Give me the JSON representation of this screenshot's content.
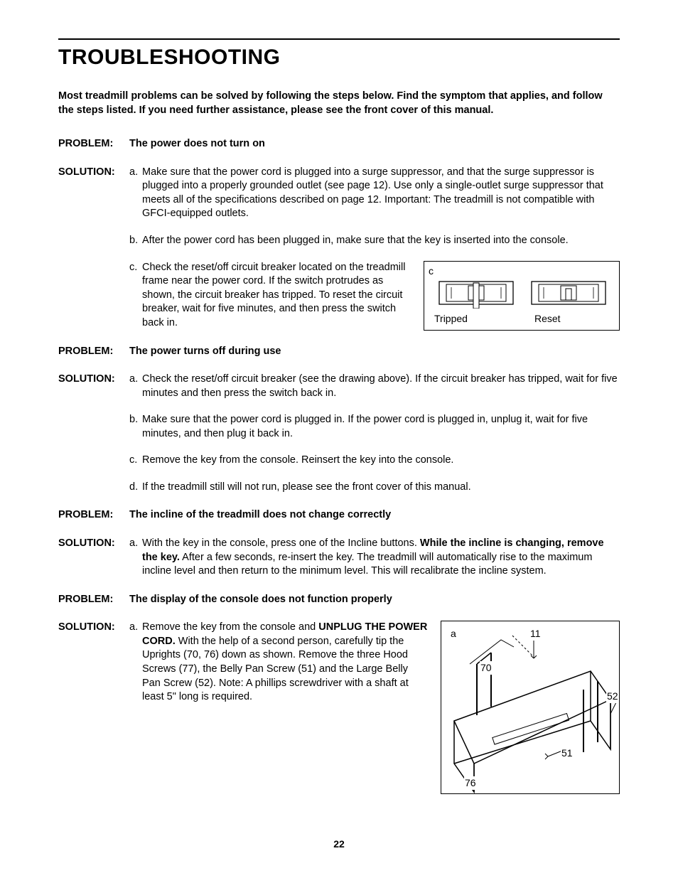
{
  "title": "TROUBLESHOOTING",
  "intro": "Most treadmill problems can be solved by following the steps below. Find the symptom that applies, and follow the steps listed. If you need further assistance, please see the front cover of this manual.",
  "labels": {
    "problem": "PROBLEM:",
    "solution": "SOLUTION:"
  },
  "p1": {
    "title": "The power does not turn on",
    "a": "Make sure that the power cord is plugged into a surge suppressor, and that the surge suppressor is plugged into a properly grounded outlet (see page 12). Use only a single-outlet surge suppressor that meets all of the specifications described on page 12. Important: The treadmill is not compatible with GFCI-equipped outlets.",
    "b": "After the power cord has been plugged in, make sure that the key is inserted into the console.",
    "c": "Check the reset/off circuit breaker located on the treadmill frame near the power cord. If the switch protrudes as shown, the circuit breaker has tripped. To reset the circuit breaker, wait for five minutes, and then press the switch back in."
  },
  "figc": {
    "label": "c",
    "tripped": "Tripped",
    "reset": "Reset"
  },
  "p2": {
    "title": "The power turns off during use",
    "a": "Check the reset/off circuit breaker (see the drawing above). If the circuit breaker has tripped, wait for five minutes and then press the switch back in.",
    "b": "Make sure that the power cord is plugged in. If the power cord is plugged in, unplug it, wait for five minutes, and then plug it back in.",
    "c": "Remove the key from the console. Reinsert the key into the console.",
    "d": "If the treadmill still will not run, please see the front cover of this manual."
  },
  "p3": {
    "title": "The incline of the treadmill does not change correctly",
    "a_pre": "With the key in the console, press one of the Incline buttons. ",
    "a_bold": "While the incline is changing, remove the key.",
    "a_post": " After a few seconds, re-insert the key. The treadmill will automatically rise to the maximum incline level and then return to the minimum level. This will recalibrate the incline system."
  },
  "p4": {
    "title": "The display of the console does not function properly",
    "a_pre": "Remove the key from the console and ",
    "a_bold": "UNPLUG THE POWER CORD.",
    "a_post": " With the help of a second person, carefully tip the Uprights (70, 76) down as shown. Remove the three Hood Screws (77), the Belly Pan Screw (51) and the Large Belly Pan Screw (52). Note: A phillips screwdriver with a shaft at least 5\" long is required."
  },
  "figa": {
    "label": "a",
    "n11": "11",
    "n70": "70",
    "n52": "52",
    "n51": "51",
    "n76": "76"
  },
  "page": "22"
}
